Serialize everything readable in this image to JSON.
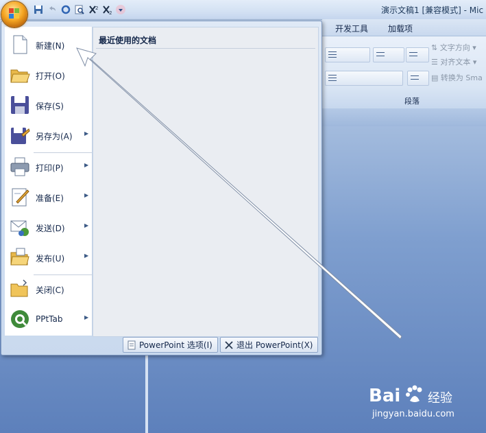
{
  "window": {
    "title": "演示文稿1 [兼容模式] - Mic"
  },
  "office_button": {
    "icon": "office-logo-icon"
  },
  "quick_access": {
    "icons": [
      "save-icon",
      "undo-icon",
      "redo-icon",
      "print-preview-icon",
      "x-icon",
      "x-subscript-icon",
      "customize-icon"
    ]
  },
  "ribbon": {
    "tabs": [
      "开发工具",
      "加载项"
    ],
    "paragraph_group": {
      "label": "段落",
      "text_direction": "文字方向",
      "align_text": "对齐文本",
      "convert_smartart": "转换为 Sma"
    }
  },
  "office_menu": {
    "items": [
      {
        "label": "新建(N)",
        "icon": "new-document-icon",
        "submenu": false
      },
      {
        "label": "打开(O)",
        "icon": "open-folder-icon",
        "submenu": false
      },
      {
        "label": "保存(S)",
        "icon": "save-disk-icon",
        "submenu": false
      },
      {
        "label": "另存为(A)",
        "icon": "save-as-icon",
        "submenu": true
      },
      {
        "label": "打印(P)",
        "icon": "printer-icon",
        "submenu": true
      },
      {
        "label": "准备(E)",
        "icon": "prepare-icon",
        "submenu": true
      },
      {
        "label": "发送(D)",
        "icon": "send-icon",
        "submenu": true
      },
      {
        "label": "发布(U)",
        "icon": "publish-icon",
        "submenu": true
      },
      {
        "label": "关闭(C)",
        "icon": "close-folder-icon",
        "submenu": false
      },
      {
        "label": "PPtTab",
        "icon": "pptab-icon",
        "submenu": true
      }
    ],
    "recent_documents_title": "最近使用的文档",
    "options_button": "PowerPoint 选项(I)",
    "exit_button": "退出 PowerPoint(X)"
  },
  "watermark": {
    "brand": "Bai",
    "brand_cn": "经验",
    "url": "jingyan.baidu.com"
  },
  "colors": {
    "accent": "#1e395b",
    "menu_bg": "#dfe9f6",
    "slide_bg": "#7f9fcf"
  }
}
